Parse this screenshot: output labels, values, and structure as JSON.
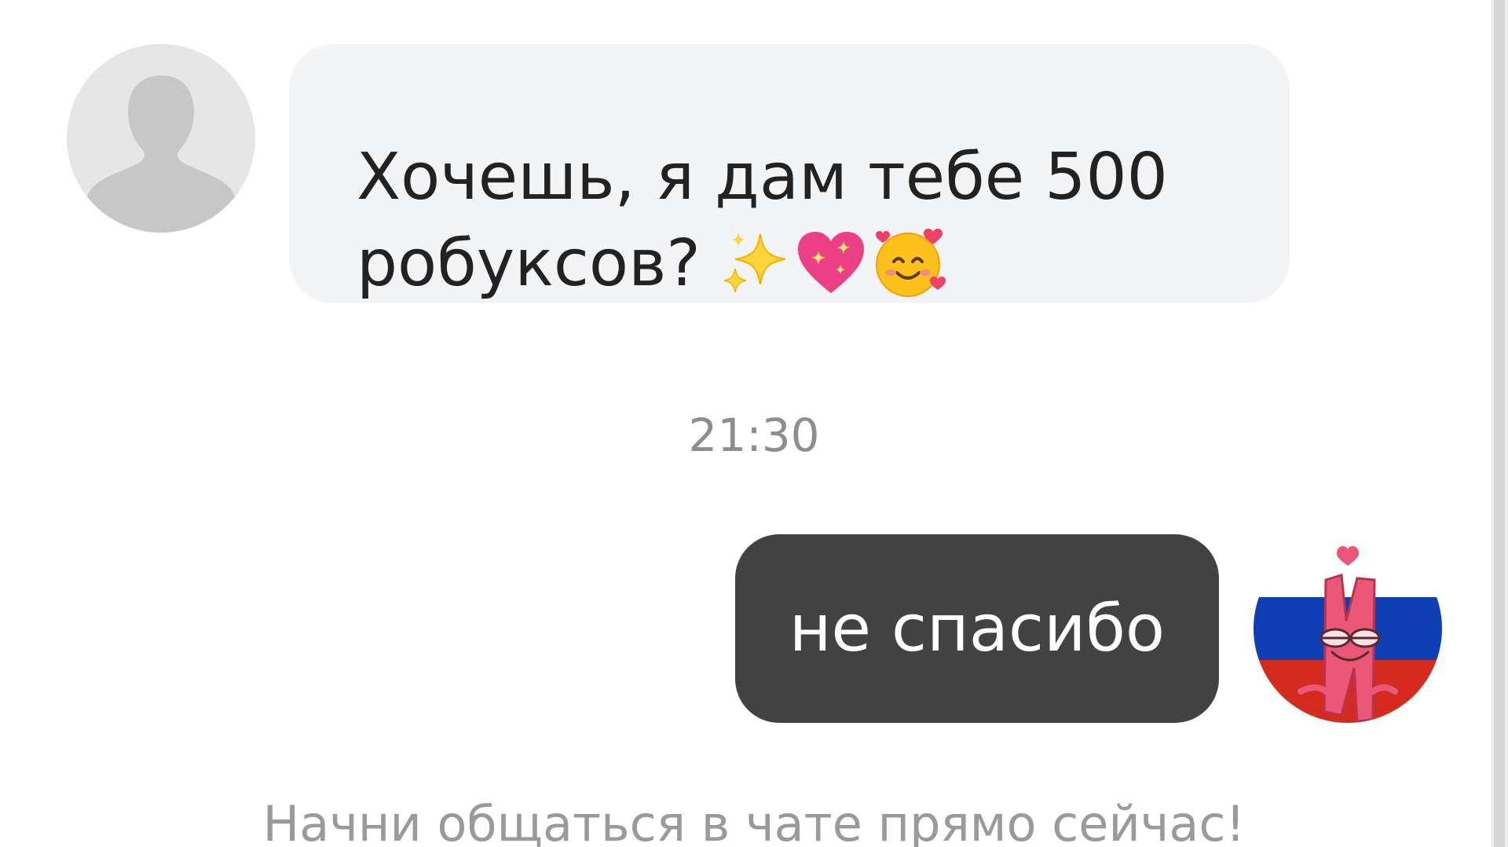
{
  "colors": {
    "background": "#ffffff",
    "incoming_bubble": "#f3f4f6",
    "outgoing_bubble": "#424242",
    "incoming_text": "#222222",
    "outgoing_text": "#ffffff",
    "timestamp": "#8e8e8e",
    "hint": "#9a9a9a"
  },
  "messages": [
    {
      "direction": "incoming",
      "avatar_icon": "default-person-avatar-icon",
      "lines": [
        "Хочешь, я дам тебе 500",
        "робуксов?"
      ],
      "emojis": [
        "sparkles-icon",
        "sparkling-heart-icon",
        "smiling-face-with-hearts-icon"
      ]
    },
    {
      "direction": "outgoing",
      "avatar_icon": "pink-character-russian-flag-avatar-icon",
      "text": "не спасибо"
    }
  ],
  "timestamp": "21:30",
  "footer_hint": "Начни общаться в чате прямо сейчас!"
}
